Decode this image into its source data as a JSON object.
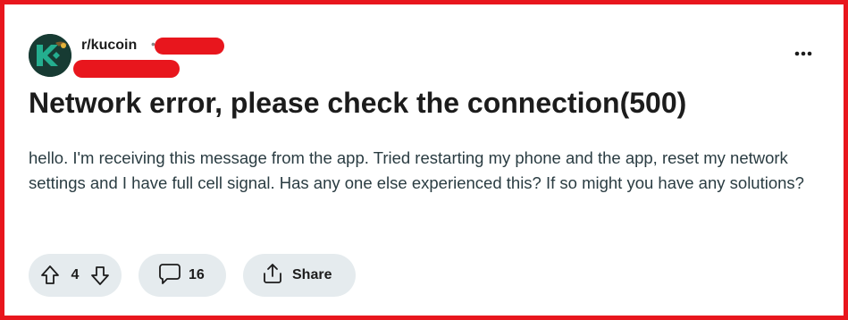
{
  "post": {
    "subreddit": "r/kucoin",
    "separator": "•",
    "title": "Network error, please check the connection(500)",
    "body": "hello. I'm receiving this message from the app. Tried restarting my phone and the app, reset my network settings and I have full cell signal. Has any one else experienced this? If so might you have any solutions?"
  },
  "actions": {
    "vote_count": "4",
    "comment_count": "16",
    "share_label": "Share"
  },
  "icons": {
    "avatar": "kucoin-logo-icon",
    "more": "more-options-icon",
    "upvote": "upvote-arrow-icon",
    "downvote": "downvote-arrow-icon",
    "comment": "comment-bubble-icon",
    "share": "share-icon"
  },
  "colors": {
    "frame": "#e8161d",
    "redaction": "#e8161d",
    "pill_bg": "#e5ebee",
    "text": "#1c1c1c",
    "body_text": "#2a3c42",
    "logo_bg": "#173b33",
    "logo_green": "#24ae8f"
  }
}
